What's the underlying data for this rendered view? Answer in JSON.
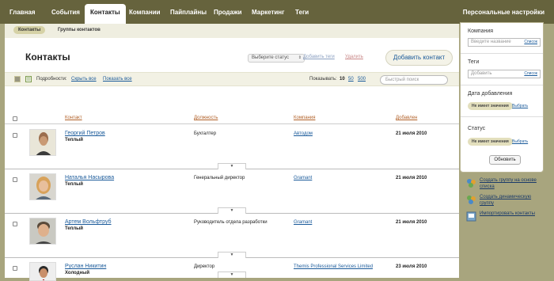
{
  "nav": {
    "tabs": [
      "Главная",
      "События",
      "Контакты",
      "Компании",
      "Пайплайны",
      "Продажи",
      "Маркетинг",
      "Теги"
    ],
    "active_tab": "Контакты",
    "settings": "Персональные настройки"
  },
  "subnav": {
    "items": [
      "Контакты",
      "Группы контактов"
    ]
  },
  "page": {
    "title": "Контакты",
    "status_select": "Выберите статус",
    "add_tags": "Добавить теги",
    "delete": "Удалить",
    "add_contact": "Добавить контакт"
  },
  "toolbar": {
    "details_label": "Подробности:",
    "hide_all": "Скрыть все",
    "show_all": "Показать все",
    "show_label": "Показывать:",
    "page_sizes": [
      "10",
      "50",
      "500"
    ],
    "search_placeholder": "Быстрый поиск"
  },
  "table": {
    "headers": {
      "contact": "Контакт",
      "position": "Должность",
      "company": "Компания",
      "added": "Добавлен"
    },
    "rows": [
      {
        "name": "Георгий Петров",
        "temp": "Теплый",
        "position": "Бухгалтер",
        "company": "Автодом",
        "date": "21 июля 2010"
      },
      {
        "name": "Наталья Насырова",
        "temp": "Теплый",
        "position": "Генеральный директор",
        "company": "Gramant",
        "date": "21 июля 2010"
      },
      {
        "name": "Артем Вольфтруб",
        "temp": "Теплый",
        "position": "Руководитель отдела разработки",
        "company": "Gramant",
        "date": "21 июля 2010"
      },
      {
        "name": "Руслан Никитин",
        "temp": "Холодный",
        "position": "Директор",
        "company": "Themis Professional Services Limited",
        "date": "23 июля 2010"
      }
    ]
  },
  "filter": {
    "company_label": "Компания",
    "company_placeholder": "Введите название",
    "list_link": "Список",
    "tags_label": "Теги",
    "tags_placeholder": "Добавить",
    "date_label": "Дата добавления",
    "no_value": "Не имеет значения",
    "choose": "Выбрать",
    "status_label": "Статус",
    "refresh": "Обновить"
  },
  "actions": [
    "Создать группу на основе списка",
    "Создать динамическую группу",
    "Импортировать контакты"
  ],
  "colors": {
    "nav_bg": "#66633d",
    "page_bg": "#a8a57e",
    "link": "#1a5a9a",
    "header": "#b2622a"
  }
}
